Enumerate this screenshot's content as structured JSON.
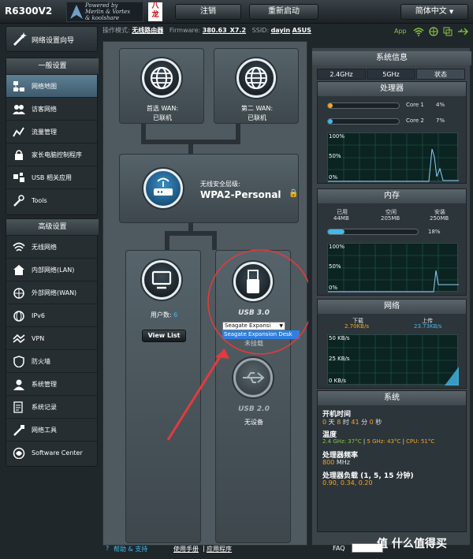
{
  "header": {
    "model": "R6300V2",
    "logo_lines": [
      "Powered by",
      "Merlin & Vortex",
      "& koolshare"
    ],
    "flag_text": "八\n龙",
    "logout": "注销",
    "reboot": "重新启动",
    "language": "简体中文",
    "app": "App"
  },
  "status": {
    "mode_label": "操作模式:",
    "mode_value": "无线路由器",
    "fw_label": "Firmware:",
    "fw_value": "380.63_X7.2",
    "ssid_label": "SSID:",
    "ssid_values": [
      "dayin",
      "ASUS"
    ]
  },
  "sidebar": {
    "wizard": "网络设置向导",
    "general_title": "一般设置",
    "general_items": [
      {
        "label": "网络地图",
        "icon": "network-map-icon",
        "active": true
      },
      {
        "label": "访客网络",
        "icon": "guest-network-icon",
        "active": false
      },
      {
        "label": "流量管理",
        "icon": "traffic-icon",
        "active": false
      },
      {
        "label": "家长电脑控制程序",
        "icon": "parental-control-icon",
        "active": false
      },
      {
        "label": "USB 相关应用",
        "icon": "usb-app-icon",
        "active": false
      },
      {
        "label": "Tools",
        "icon": "tools-icon",
        "active": false
      }
    ],
    "advanced_title": "高级设置",
    "advanced_items": [
      {
        "label": "无线网络",
        "icon": "wireless-icon"
      },
      {
        "label": "内部网络(LAN)",
        "icon": "lan-icon"
      },
      {
        "label": "外部网络(WAN)",
        "icon": "wan-icon"
      },
      {
        "label": "IPv6",
        "icon": "ipv6-icon"
      },
      {
        "label": "VPN",
        "icon": "vpn-icon"
      },
      {
        "label": "防火墙",
        "icon": "firewall-icon"
      },
      {
        "label": "系统管理",
        "icon": "admin-icon"
      },
      {
        "label": "系统记录",
        "icon": "log-icon"
      },
      {
        "label": "网络工具",
        "icon": "network-tools-icon"
      },
      {
        "label": "Software Center",
        "icon": "software-center-icon"
      }
    ]
  },
  "map": {
    "wan1_title": "首选 WAN:",
    "wan1_status": "已联机",
    "wan2_title": "第二 WAN:",
    "wan2_status": "已联机",
    "security_label": "无线安全层级:",
    "security_value": "WPA2-Personal",
    "clients_label": "用户数:",
    "clients_count": "6",
    "view_list": "View List",
    "usb3_label": "USB 3.0",
    "usb3_select": "Seagate Expansi",
    "usb3_option": "Seagate Expansion Desk",
    "usb3_sub": "未挂载",
    "usb2_label": "USB 2.0",
    "usb2_status": "无设备"
  },
  "sysinfo": {
    "title": "系统信息",
    "tabs": [
      "2.4GHz",
      "5GHz",
      "状态"
    ],
    "cpu_title": "处理器",
    "core1_label": "Core 1",
    "core1_pct": "4%",
    "core1_value": 4,
    "core2_label": "Core 2",
    "core2_pct": "7%",
    "core2_value": 7,
    "graph_labels": [
      "100%",
      "50%",
      "0%"
    ],
    "mem_title": "内存",
    "mem_used_label": "已用",
    "mem_used": "44MB",
    "mem_free_label": "空闲",
    "mem_free": "205MB",
    "mem_total_label": "安装",
    "mem_total": "250MB",
    "mem_pct": "18%",
    "mem_value": 18,
    "net_title": "网络",
    "down_label": "下载",
    "down_value": "2.70KB/s",
    "up_label": "上传",
    "up_value": "23.73KB/s",
    "net_graph_labels": [
      "50 KB/s",
      "25 KB/s",
      "0 KB/s"
    ],
    "sys_title": "系统",
    "uptime_label": "开机时间",
    "uptime": [
      {
        "v": "0",
        "u": "天"
      },
      {
        "v": "8",
        "u": "时"
      },
      {
        "v": "41",
        "u": "分"
      },
      {
        "v": "0",
        "u": "秒"
      }
    ],
    "temp_label": "温度",
    "temp_24": "2.4 GHz: 37°C",
    "temp_5": "5 GHz: 43°C",
    "temp_cpu": "CPU: 51°C",
    "freq_label": "处理器频率",
    "freq_value": "800",
    "freq_unit": "MHz",
    "load_label": "处理器负载 (1, 5, 15 分钟)",
    "load_value": "0.90,  0.34,  0.20"
  },
  "footer": {
    "help": "帮助 & 支持",
    "manual": "使用手册",
    "sep": "|",
    "app": "应用程序",
    "faq": "FAQ",
    "watermark": "值 什么值得买"
  },
  "colors": {
    "accent": "#43b9ea",
    "orange": "#f5a623",
    "green": "#87c540",
    "annotation": "#e23b3b"
  }
}
